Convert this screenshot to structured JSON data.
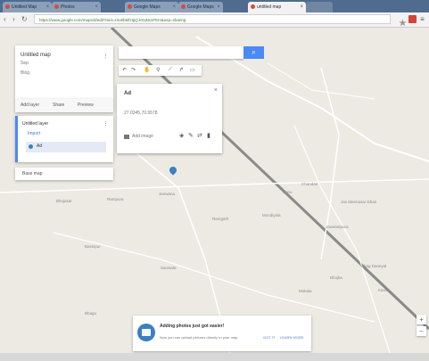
{
  "browser": {
    "tabs": [
      {
        "label": "Untitled Map"
      },
      {
        "label": "Photos"
      },
      {
        "label": "Google Maps"
      },
      {
        "label": "Google Maps"
      },
      {
        "label": "untitled map"
      },
      {
        "label": ""
      }
    ],
    "url": "https://www.google.com/maps/d/edit?mid=z3o0b5ifzlgQ.kXqNcsFEIs&usp=sharing"
  },
  "panel": {
    "title": "Untitled map",
    "subtitle": "Sep",
    "description": "Blog",
    "actions": [
      "Add layer",
      "Share",
      "Preview"
    ],
    "layer_name": "Untitled layer",
    "import_link": "Import",
    "item": "Ad",
    "basemap": "Base map"
  },
  "infowindow": {
    "title": "Ad",
    "coords": "27.0345,70.9578",
    "add_label": "Add image"
  },
  "map_labels": [
    "Bhojasar",
    "Rampura",
    "Jeewana",
    "Ramgarh",
    "Mondiyala",
    "Jas Meenasar Dhan",
    "Jaswantpura",
    "Chandan",
    "Sonu",
    "Basnipur",
    "Sanwata",
    "Mokala",
    "Bhojka",
    "Bhagu",
    "Bhag Daneyal",
    "Kanoi"
  ],
  "toast": {
    "title": "Adding photos just got easier!",
    "text": "Now you can upload pictures directly to your map.",
    "got_it": "GOT IT",
    "learn_more": "LEARN MORE"
  },
  "colors": {
    "map_bg": "#eceae3",
    "road": "#ffffff",
    "highway": "#8a8a8a",
    "accent": "#4a8af4",
    "pin": "#3b7fc4"
  }
}
